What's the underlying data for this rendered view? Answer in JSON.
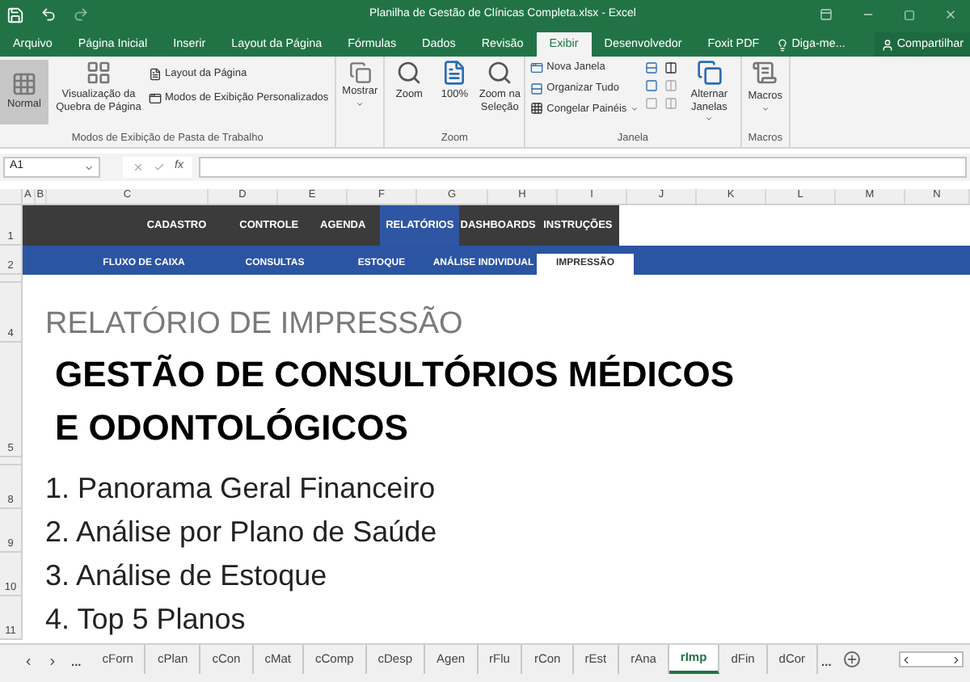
{
  "window": {
    "title": "Planilha de Gestão de Clínicas Completa.xlsx - Excel"
  },
  "menu_tabs": [
    {
      "label": "Arquivo",
      "selected": false
    },
    {
      "label": "Página Inicial",
      "selected": false
    },
    {
      "label": "Inserir",
      "selected": false
    },
    {
      "label": "Layout da Página",
      "selected": false
    },
    {
      "label": "Fórmulas",
      "selected": false
    },
    {
      "label": "Dados",
      "selected": false
    },
    {
      "label": "Revisão",
      "selected": false
    },
    {
      "label": "Exibir",
      "selected": true
    },
    {
      "label": "Desenvolvedor",
      "selected": false
    },
    {
      "label": "Foxit PDF",
      "selected": false
    }
  ],
  "tell_me": "Diga-me...",
  "share": "Compartilhar",
  "ribbon": {
    "views_group": {
      "label": "Modos de Exibição de Pasta de Trabalho",
      "normal": {
        "label": "Normal",
        "selected": true
      },
      "page_break": "Visualização da Quebra de Página",
      "page_layout": "Layout da Página",
      "custom_views": "Modos de Exibição Personalizados"
    },
    "show": "Mostrar",
    "zoom_group": {
      "label": "Zoom",
      "buttons": [
        "Zoom",
        "100%",
        "Zoom na Seleção"
      ]
    },
    "window_group": {
      "label": "Janela",
      "new_window": "Nova Janela",
      "arrange_all": "Organizar Tudo",
      "freeze_panes": "Congelar Painéis",
      "switch_windows": "Alternar Janelas"
    },
    "macros_group": {
      "label": "Macros",
      "button": "Macros"
    }
  },
  "name_box": "A1",
  "fx": "fx",
  "columns": [
    "A",
    "B",
    "C",
    "D",
    "E",
    "F",
    "G",
    "H",
    "I",
    "J",
    "K",
    "L",
    "M",
    "N"
  ],
  "nav_menu": [
    {
      "label": "CADASTRO",
      "selected": false
    },
    {
      "label": "CONTROLE",
      "selected": false
    },
    {
      "label": "AGENDA",
      "selected": false
    },
    {
      "label": "RELATÓRIOS",
      "selected": true
    },
    {
      "label": "DASHBOARDS",
      "selected": false
    },
    {
      "label": "INSTRUÇÕES",
      "selected": false
    }
  ],
  "sub_menu": [
    {
      "label": "FLUXO DE CAIXA",
      "selected": false
    },
    {
      "label": "CONSULTAS",
      "selected": false
    },
    {
      "label": "ESTOQUE",
      "selected": false
    },
    {
      "label": "ANÁLISE INDIVIDUAL",
      "selected": false
    },
    {
      "label": "IMPRESSÃO",
      "selected": true
    }
  ],
  "rows": [
    {
      "number": "1",
      "kind": "nav"
    },
    {
      "number": "2",
      "kind": "sub"
    },
    {
      "kind": "spacer"
    },
    {
      "number": "4",
      "kind": "subtitle",
      "text": "RELATÓRIO DE IMPRESSÃO"
    },
    {
      "number": "5",
      "kind": "title",
      "text": "GESTÃO DE CONSULTÓRIOS MÉDICOS",
      "text2": "E ODONTOLÓGICOS"
    },
    {
      "kind": "spacer"
    },
    {
      "number": "8",
      "kind": "item",
      "text": "1. Panorama Geral Financeiro"
    },
    {
      "number": "9",
      "kind": "item",
      "text": "2. Análise por Plano de Saúde"
    },
    {
      "number": "10",
      "kind": "item",
      "text": "3. Análise de Estoque"
    },
    {
      "number": "11",
      "kind": "item",
      "text": "4. Top 5 Planos"
    }
  ],
  "sheet_tabs": {
    "more": "...",
    "tabs": [
      {
        "label": "cForn",
        "selected": false
      },
      {
        "label": "cPlan",
        "selected": false
      },
      {
        "label": "cCon",
        "selected": false
      },
      {
        "label": "cMat",
        "selected": false
      },
      {
        "label": "cComp",
        "selected": false
      },
      {
        "label": "cDesp",
        "selected": false
      },
      {
        "label": "Agen",
        "selected": false
      },
      {
        "label": "rFlu",
        "selected": false
      },
      {
        "label": "rCon",
        "selected": false
      },
      {
        "label": "rEst",
        "selected": false
      },
      {
        "label": "rAna",
        "selected": false
      },
      {
        "label": "rImp",
        "selected": true
      },
      {
        "label": "dFin",
        "selected": false
      },
      {
        "label": "dCor",
        "selected": false
      }
    ],
    "more_right": "..."
  }
}
